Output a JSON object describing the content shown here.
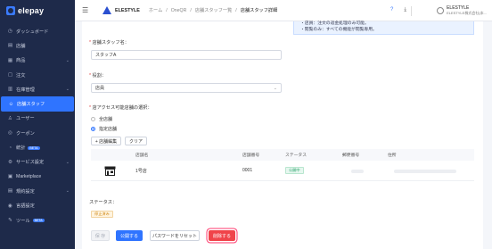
{
  "app": {
    "logo_text": "elepay"
  },
  "sidebar": {
    "items": [
      {
        "label": "ダッシュボード",
        "icon": "dashboard-icon",
        "glyph": "◷"
      },
      {
        "label": "店舗",
        "icon": "store-icon",
        "glyph": "▤"
      },
      {
        "label": "商品",
        "icon": "product-icon",
        "glyph": "▦",
        "chevron": "⌄"
      },
      {
        "label": "注文",
        "icon": "order-icon",
        "glyph": "▢"
      },
      {
        "label": "在庫管理",
        "icon": "inventory-icon",
        "glyph": "▥",
        "chevron": "⌄"
      },
      {
        "label": "店舗スタッフ",
        "icon": "staff-icon",
        "glyph": "☺",
        "active": true
      },
      {
        "label": "ユーザー",
        "icon": "user-icon",
        "glyph": "♙"
      },
      {
        "label": "クーポン",
        "icon": "coupon-icon",
        "glyph": "◎"
      },
      {
        "label": "統計",
        "icon": "stats-icon",
        "glyph": "◔",
        "badge": "BETA"
      },
      {
        "label": "サービス設定",
        "icon": "service-icon",
        "glyph": "⚙",
        "chevron": "⌄"
      },
      {
        "label": "Marketplace",
        "icon": "marketplace-icon",
        "glyph": "▣"
      },
      {
        "label": "規約設定",
        "icon": "terms-icon",
        "glyph": "▤",
        "chevron": "⌄"
      },
      {
        "label": "言語設定",
        "icon": "language-icon",
        "glyph": "◉"
      },
      {
        "label": "ツール",
        "icon": "tool-icon",
        "glyph": "✎",
        "badge": "BETA"
      }
    ]
  },
  "header": {
    "brand": "ELESTYLE",
    "breadcrumbs": [
      "ホーム",
      "OneQR",
      "店舗スタッフ一覧",
      "店舗スタッフ詳細"
    ],
    "crumb_sep": "/",
    "user_name": "ELESTYLE",
    "user_company": "ELESTYLE株式会社(本..."
  },
  "info_box": {
    "line1": "・店員：注文の返金処理のみ可能。",
    "line2": "・閲覧のみ：すべての機能が閲覧専用。"
  },
  "form": {
    "name_label": "店舗スタッフ名：",
    "name_value": "スタッフA",
    "role_label": "役割：",
    "role_value": "店員",
    "access_label": "店アクセス可能店舗の選択：",
    "radio_all": "全店舗",
    "radio_specific": "指定店舗",
    "edit_stores_btn": "+ 店舗編集",
    "clear_btn": "クリア",
    "required_mark": "*"
  },
  "table": {
    "headers": [
      "店舗名",
      "店舗番号",
      "ステータス",
      "郵便番号",
      "住所"
    ],
    "rows": [
      {
        "name": "1号店",
        "number": "0001",
        "status": "公開中"
      }
    ]
  },
  "status_section": {
    "label": "ステータス：",
    "value": "停止済み"
  },
  "footer": {
    "save_btn": "保 存",
    "publish_btn": "公開する",
    "reset_pw_btn": "パスワードをリセット",
    "delete_btn": "削除する"
  }
}
